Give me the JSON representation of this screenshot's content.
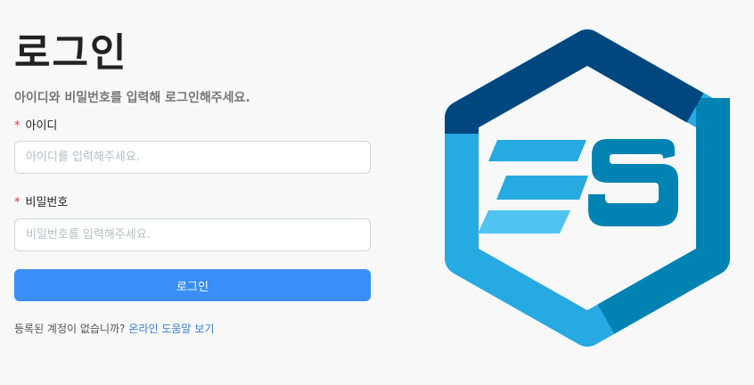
{
  "login": {
    "title": "로그인",
    "subtitle": "아이디와 비밀번호를 입력해 로그인해주세요.",
    "required_mark": "*",
    "id_label": "아이디",
    "id_placeholder": "아이디를 입력해주세요.",
    "password_label": "비밀번호",
    "password_placeholder": "비밀번호를 입력해주세요.",
    "submit_label": "로그인",
    "signup_prompt": "등록된 계정이 없습니까?",
    "help_link": "온라인 도움말 보기"
  },
  "colors": {
    "primary_button": "#3a8ef8",
    "required": "#e5352c",
    "link": "#3a7bd5",
    "logo_dark_blue": "#00467f",
    "logo_teal": "#0083b3",
    "logo_light_blue": "#27a9e1"
  },
  "icons": {
    "logo": "es-hexagon-logo"
  }
}
